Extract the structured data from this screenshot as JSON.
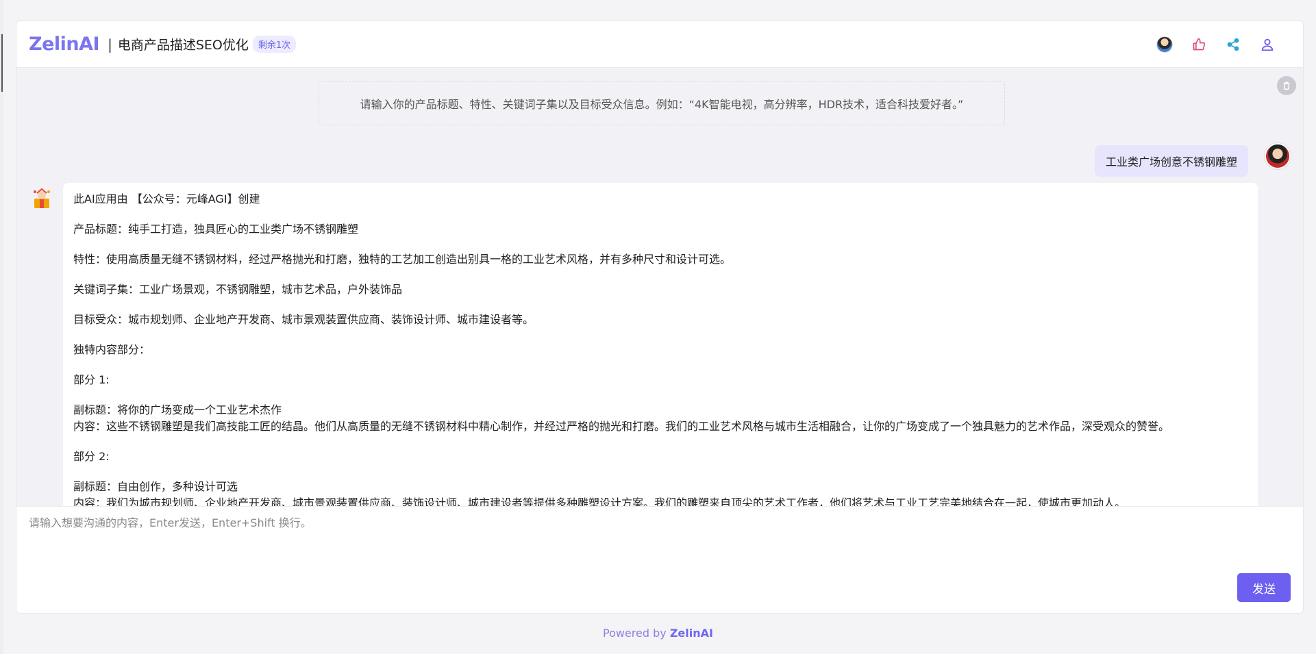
{
  "header": {
    "logo_text": "ZelinAI",
    "separator": "|",
    "app_title": "电商产品描述SEO优化",
    "remaining_badge": "剩余1次",
    "icons": [
      "user-avatar-icon",
      "thumbs-up-icon",
      "share-icon",
      "user-profile-icon"
    ]
  },
  "chat": {
    "hint": "请输入你的产品标题、特性、关键词子集以及目标受众信息。例如：“4K智能电视，高分辨率，HDR技术，适合科技爱好者。”",
    "user_message": "工业类广场创意不锈钢雕塑",
    "bot_lines": [
      "此AI应用由 【公众号：元峰AGI】创建",
      "产品标题：纯手工打造，独具匠心的工业类广场不锈钢雕塑",
      "特性：使用高质量无缝不锈钢材料，经过严格抛光和打磨，独特的工艺加工创造出别具一格的工业艺术风格，并有多种尺寸和设计可选。",
      "关键词子集：工业广场景观，不锈钢雕塑，城市艺术品，户外装饰品",
      "目标受众：城市规划师、企业地产开发商、城市景观装置供应商、装饰设计师、城市建设者等。",
      "独特内容部分：",
      "部分 1:",
      "副标题：将你的广场变成一个工业艺术杰作",
      "内容：这些不锈钢雕塑是我们高技能工匠的结晶。他们从高质量的无缝不锈钢材料中精心制作，并经过严格的抛光和打磨。我们的工业艺术风格与城市生活相融合，让你的广场变成了一个独具魅力的艺术作品，深受观众的赞誉。",
      "部分 2:",
      "副标题：自由创作，多种设计可选",
      "内容：我们为城市规划师、企业地产开发商、城市景观装置供应商、装饰设计师、城市建设者等提供多种雕塑设计方案。我们的雕塑来自顶尖的艺术工作者，他们将艺术与工业工艺完美地结合在一起，使城市更加动人。"
    ]
  },
  "composer": {
    "placeholder": "请输入想要沟通的内容，Enter发送，Enter+Shift 换行。",
    "send_label": "发送"
  },
  "footer": {
    "powered_by": "Powered by",
    "brand": "ZelinAI"
  },
  "colors": {
    "accent": "#6d5ff0",
    "user_bubble": "#e7e4fd",
    "badge_bg": "#ecebff"
  }
}
